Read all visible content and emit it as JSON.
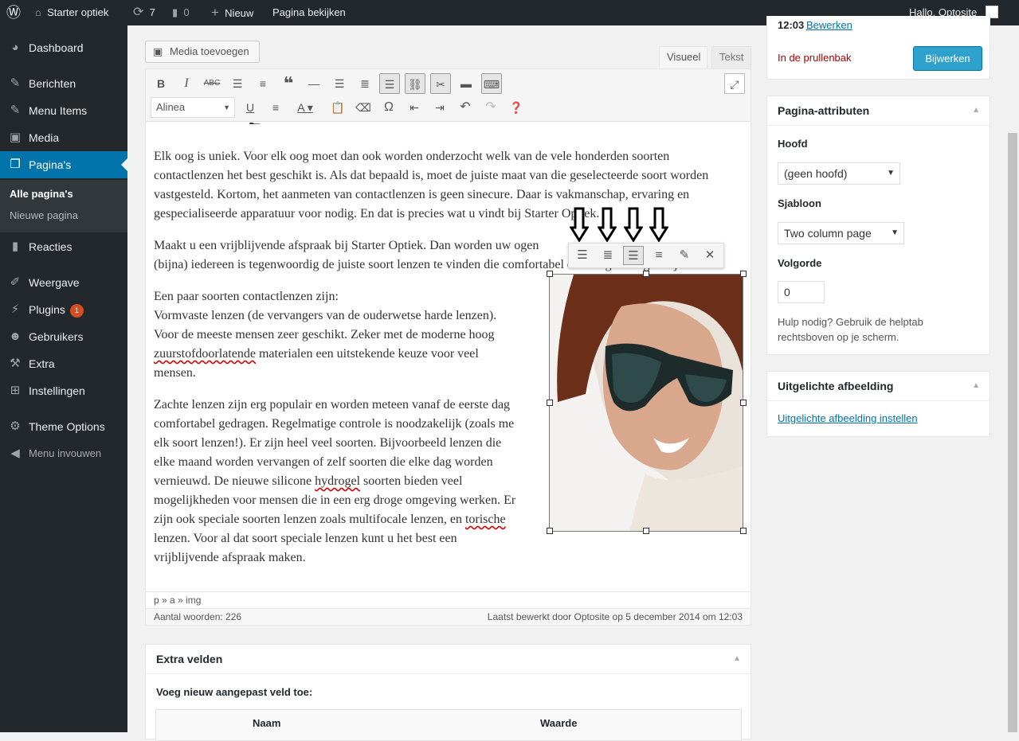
{
  "admin_bar": {
    "site_name": "Starter optiek",
    "updates_count": "7",
    "comments_count": "0",
    "new_label": "Nieuw",
    "view_page": "Pagina bekijken",
    "greeting": "Hallo, Optosite"
  },
  "sidebar": {
    "items": [
      {
        "label": "Dashboard",
        "icon": "dashboard-icon"
      },
      {
        "label": "Berichten",
        "icon": "pin-icon"
      },
      {
        "label": "Menu Items",
        "icon": "pin-icon"
      },
      {
        "label": "Media",
        "icon": "media-icon"
      },
      {
        "label": "Pagina's",
        "icon": "pages-icon"
      },
      {
        "label": "Reacties",
        "icon": "comment-icon"
      },
      {
        "label": "Weergave",
        "icon": "brush-icon"
      },
      {
        "label": "Plugins",
        "icon": "plugin-icon",
        "badge": "1"
      },
      {
        "label": "Gebruikers",
        "icon": "user-icon"
      },
      {
        "label": "Extra",
        "icon": "wrench-icon"
      },
      {
        "label": "Instellingen",
        "icon": "settings-icon"
      },
      {
        "label": "Theme Options",
        "icon": "gear-icon"
      },
      {
        "label": "Menu invouwen",
        "icon": "collapse-icon"
      }
    ],
    "submenu": [
      "Alle pagina's",
      "Nieuwe pagina"
    ]
  },
  "editor": {
    "add_media": "Media toevoegen",
    "tab_visual": "Visueel",
    "tab_text": "Tekst",
    "format_select": "Alinea",
    "paragraphs": {
      "p1": "Elk oog is uniek. Voor elk oog moet dan ook worden onderzocht welk van de vele honderden soorten contactlenzen het best geschikt is. Als dat bepaald is, moet de juiste maat van die geselecteerde soort worden vastgesteld. Kortom, het aanmeten van contactlenzen is geen sinecure. Daar is vakmanschap, ervaring en gespecialiseerde apparatuur voor nodig. En dat is precies wat u vindt bij Starter Optiek.",
      "p2a": "Maakt u een vrijblijvende afspraak bij Starter Optiek. Dan worden uw ogen",
      "p2b": "(bijna) iedereen is tegenwoordig de juiste soort lenzen te vinden die comfortabel en veilig te dragen zijn.",
      "p3_lines": [
        "Een paar soorten contactlenzen zijn:",
        "Vormvaste lenzen (de vervangers van de ouderwetse harde lenzen).",
        "Voor de meeste mensen zeer geschikt. Zeker met de moderne hoog"
      ],
      "p3_word": "zuurstofdoorlatende",
      "p3_rest": " materialen een uitstekende keuze voor veel",
      "p3_last": "mensen.",
      "p4_lines": [
        "Zachte lenzen zijn erg populair en worden meteen vanaf de eerste dag",
        "comfortabel gedragen. Regelmatige controle is noodzakelijk (zoals me",
        "elk soort lenzen!). Er zijn heel veel soorten. Bijvoorbeeld lenzen die",
        "elke maand worden vervangen of zelf soorten die elke dag worden"
      ],
      "p4_l5a": "vernieuwd. De nieuwe silicone ",
      "p4_l5w": "hydrogel",
      "p4_l5b": " soorten bieden veel",
      "p4_l6": "mogelijkheden voor mensen die in een erg droge omgeving werken. Er",
      "p4_l7a": "zijn ook speciale soorten lenzen zoals multifocale lenzen, en ",
      "p4_l7w": "torische",
      "p4_l8": "lenzen. Voor al dat soort speciale lenzen kunt u het best een",
      "p4_l9": "vrijblijvende afspraak maken."
    },
    "path": "p » a » img",
    "word_count": "Aantal woorden: 226",
    "last_edited": "Laatst bewerkt door Optosite op 5 december 2014 om 12:03"
  },
  "publish": {
    "time": "12:03",
    "edit_link": "Bewerken",
    "trash": "In de prullenbak",
    "update": "Bijwerken"
  },
  "page_attributes": {
    "title": "Pagina-attributen",
    "parent_label": "Hoofd",
    "parent_value": "(geen hoofd)",
    "template_label": "Sjabloon",
    "template_value": "Two column page",
    "order_label": "Volgorde",
    "order_value": "0",
    "help": "Hulp nodig? Gebruik de helptab rechtsboven op je scherm."
  },
  "featured_image": {
    "title": "Uitgelichte afbeelding",
    "link": "Uitgelichte afbeelding instellen"
  },
  "custom_fields": {
    "title": "Extra velden",
    "add_label": "Voeg nieuw aangepast veld toe:",
    "col_name": "Naam",
    "col_value": "Waarde"
  },
  "colors": {
    "accent": "#0073aa",
    "adminbar": "#23282d",
    "button": "#2ea2cc",
    "trash": "#a00"
  }
}
